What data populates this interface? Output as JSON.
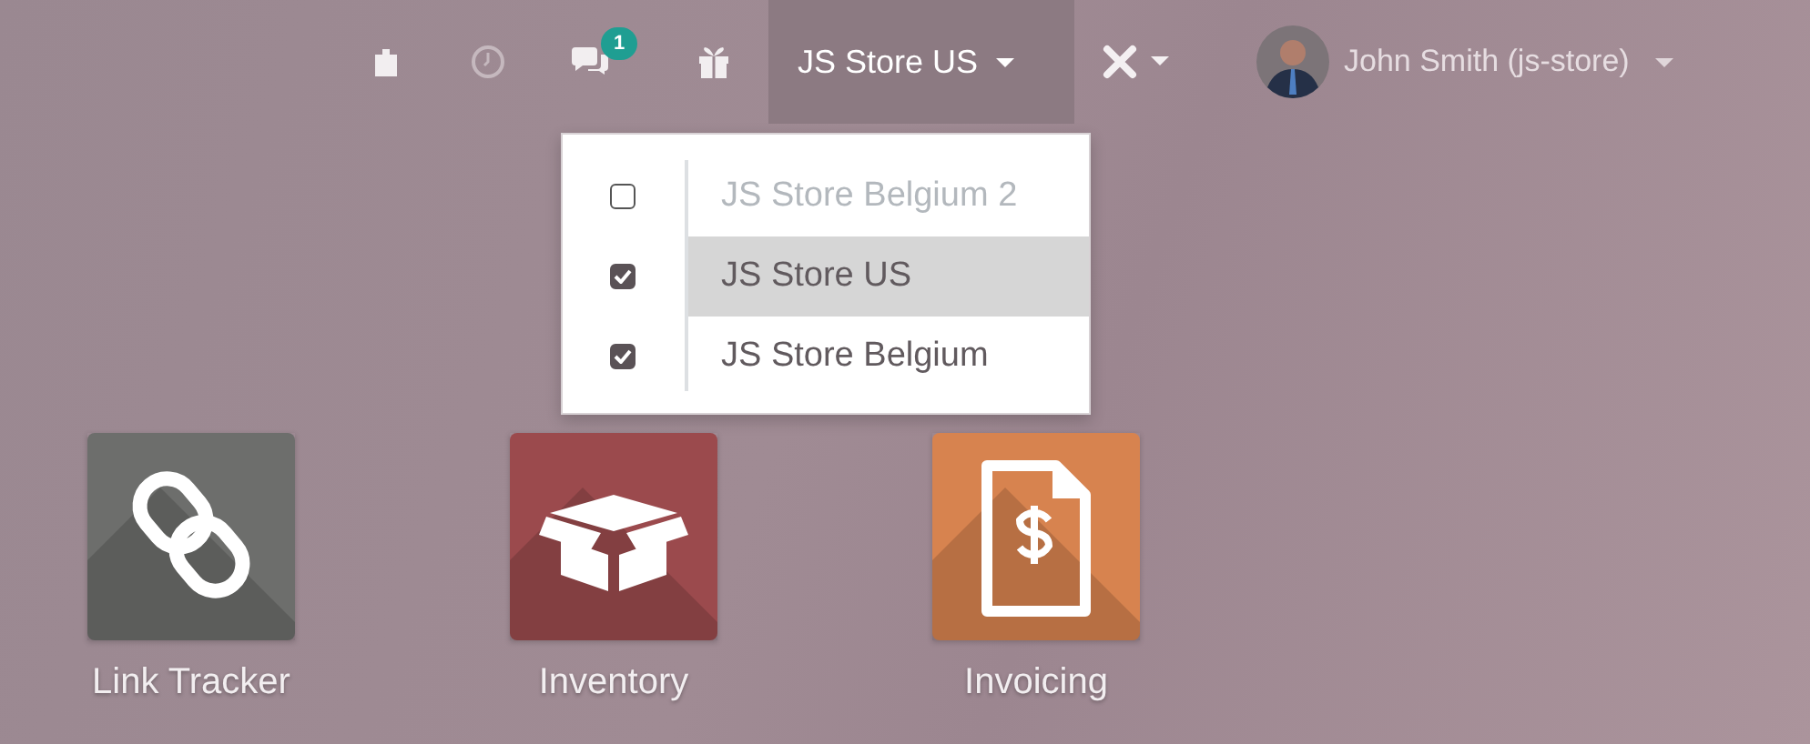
{
  "topbar": {
    "chat_badge": "1",
    "company_switcher": {
      "label": "JS Store US",
      "expanded": true
    },
    "user": {
      "name": "John Smith (js-store)"
    }
  },
  "company_menu": [
    {
      "label": "JS Store Belgium 2",
      "checked": false,
      "selected": false
    },
    {
      "label": "JS Store US",
      "checked": true,
      "selected": true
    },
    {
      "label": "JS Store Belgium",
      "checked": true,
      "selected": false
    }
  ],
  "apps": [
    {
      "label": "Link Tracker",
      "kind": "link"
    },
    {
      "label": "Inventory",
      "kind": "box"
    },
    {
      "label": "Invoicing",
      "kind": "invoice"
    }
  ]
}
